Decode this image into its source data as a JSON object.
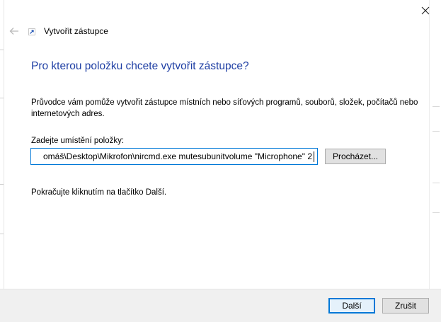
{
  "window": {
    "title": "Vytvořit zástupce",
    "icons": {
      "close": "close-icon",
      "back": "back-arrow-icon",
      "app": "shortcut-icon"
    }
  },
  "wizard": {
    "heading": "Pro kterou položku chcete vytvořit zástupce?",
    "description": "Průvodce vám pomůže vytvořit zástupce místních nebo síťových programů, souborů, složek, počítačů nebo internetových adres.",
    "location_label": "Zadejte umístění položky:",
    "location_value": "omáš\\Desktop\\Mikrofon\\nircmd.exe mutesubunitvolume \"Microphone\" 2",
    "browse_label": "Procházet...",
    "hint": "Pokračujte kliknutím na tlačítko Další."
  },
  "footer": {
    "next_label": "Další",
    "cancel_label": "Zrušit"
  },
  "colors": {
    "heading": "#1f3fa4",
    "accent": "#0078d7",
    "footer_bg": "#f0f0f0"
  }
}
